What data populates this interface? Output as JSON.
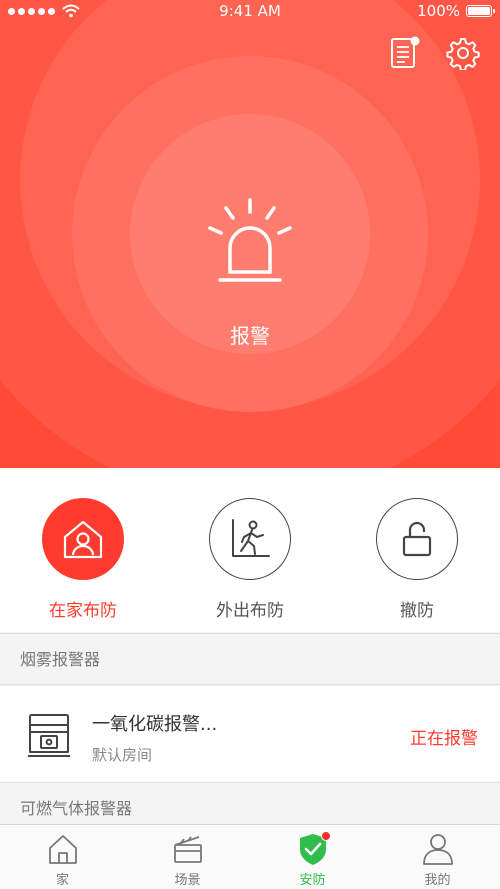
{
  "status_bar": {
    "time": "9:41 AM",
    "battery": "100%"
  },
  "header": {
    "alarm_label": "报警"
  },
  "modes": [
    {
      "label": "在家布防",
      "icon": "home-user-icon",
      "active": true
    },
    {
      "label": "外出布防",
      "icon": "walking-out-icon",
      "active": false
    },
    {
      "label": "撤防",
      "icon": "unlock-icon",
      "active": false
    }
  ],
  "sections": [
    {
      "title": "烟雾报警器"
    },
    {
      "title": "可燃气体报警器"
    }
  ],
  "device": {
    "name": "一氧化碳报警...",
    "room": "默认房间",
    "status": "正在报警",
    "icon": "co-detector-icon"
  },
  "tabs": [
    {
      "label": "家",
      "icon": "home-icon"
    },
    {
      "label": "场景",
      "icon": "clapperboard-icon"
    },
    {
      "label": "安防",
      "icon": "shield-check-icon",
      "active": true
    },
    {
      "label": "我的",
      "icon": "person-icon"
    }
  ],
  "colors": {
    "accent": "#ff3b2f",
    "hero": "#ff4430",
    "tab_active": "#2fbe4b"
  }
}
